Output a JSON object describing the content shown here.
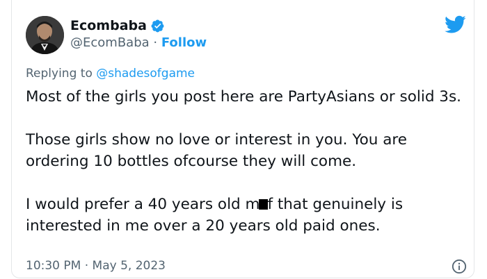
{
  "author": {
    "display_name": "Ecombaba",
    "handle": "@EcomBaba",
    "separator": "·",
    "follow_label": "Follow"
  },
  "reply": {
    "prefix": "Replying to",
    "target": "@shadesofgame"
  },
  "tweet": {
    "para1": "Most of the girls you post here are PartyAsians or solid 3s.",
    "para2": "Those girls show no love or interest in you. You are ordering 10 bottles ofcourse they will come.",
    "para3_before": "I would prefer a 40 years old m",
    "para3_after": "f that genuinely is interested in me over a 20 years old paid ones."
  },
  "meta": {
    "timestamp": "10:30 PM · May 5, 2023"
  },
  "colors": {
    "accent": "#1d9bf0",
    "text": "#0f1419",
    "secondary": "#536471"
  },
  "icons": {
    "brand": "twitter-bird-icon",
    "verified": "verified-badge-icon",
    "info": "info-icon"
  }
}
